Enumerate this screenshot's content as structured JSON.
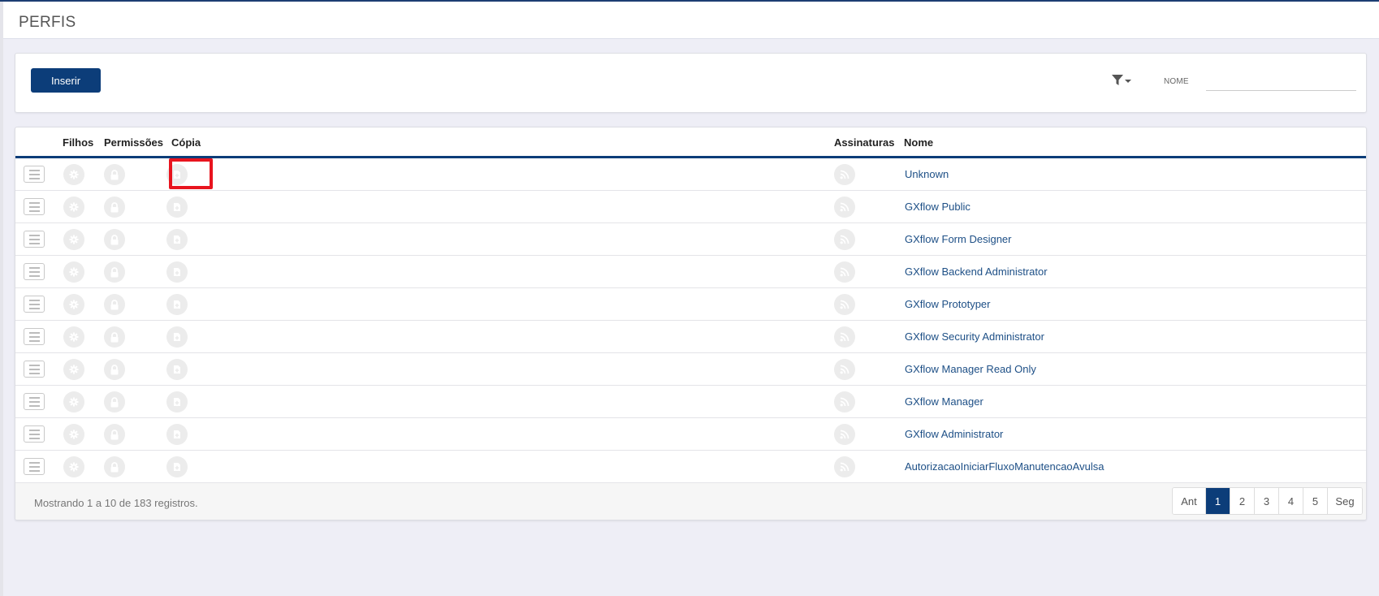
{
  "header": {
    "title": "PERFIS"
  },
  "toolbar": {
    "insert_label": "Inserir",
    "filter_label": "NOME",
    "filter_value": "",
    "filter_placeholder": ""
  },
  "grid": {
    "columns": {
      "filhos": "Filhos",
      "permissoes": "Permissões",
      "copia": "Cópia",
      "assinaturas": "Assinaturas",
      "nome": "Nome"
    },
    "rows": [
      {
        "name": "Unknown"
      },
      {
        "name": "GXflow Public"
      },
      {
        "name": "GXflow Form Designer"
      },
      {
        "name": "GXflow Backend Administrator"
      },
      {
        "name": "GXflow Prototyper"
      },
      {
        "name": "GXflow Security Administrator"
      },
      {
        "name": "GXflow Manager Read Only"
      },
      {
        "name": "GXflow Manager"
      },
      {
        "name": "GXflow Administrator"
      },
      {
        "name": "AutorizacaoIniciarFluxoManutencaoAvulsa"
      }
    ],
    "highlighted_row": 0,
    "footer_text": "Mostrando 1 a 10 de 183 registros."
  },
  "pagination": {
    "prev_label": "Ant",
    "next_label": "Seg",
    "pages": [
      "1",
      "2",
      "3",
      "4",
      "5"
    ],
    "active_page": "1"
  },
  "colors": {
    "primary": "#0c3d79",
    "link": "#1d4f86",
    "highlight": "#e8141e",
    "icon_bg": "#ececec"
  },
  "icons": {
    "row_menu": "list-icon",
    "filhos": "gear-icon",
    "permissoes": "lock-icon",
    "copia": "copy-icon",
    "assinaturas": "rss-icon",
    "filter": "filter-icon"
  }
}
